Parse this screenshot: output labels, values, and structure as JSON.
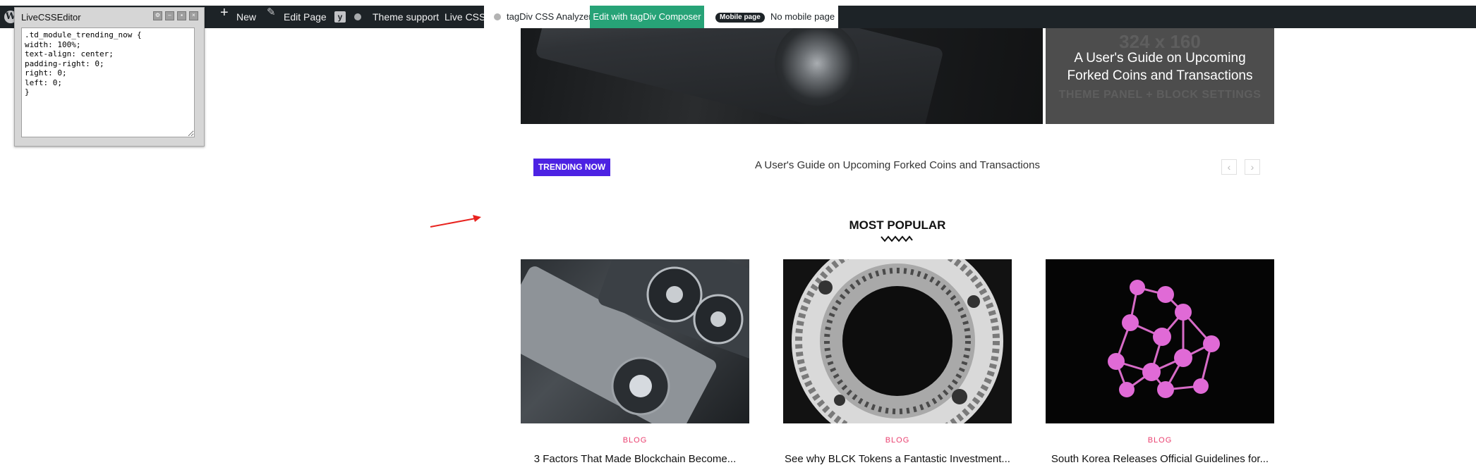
{
  "admin_bar": {
    "new_label": "New",
    "edit_page_label": "Edit Page",
    "theme_support_label": "Theme support",
    "live_css_label": "Live CSS",
    "css_analyzer_label": "tagDiv CSS Analyzer",
    "composer_label": "Edit with tagDiv Composer",
    "mobile_badge": "Mobile page",
    "no_mobile_label": "No mobile page",
    "composer_color": "#27a377"
  },
  "editor": {
    "title": "LiveCSSEditor",
    "code": ".td_module_trending_now {\nwidth: 100%;\ntext-align: center;\npadding-right: 0;\nright: 0;\nleft: 0;\n}"
  },
  "hero": {
    "placeholder_size": "324 x 160",
    "placeholder_sub": "THEME PANEL + BLOCK SETTINGS",
    "right_title": "A User's Guide on Upcoming Forked Coins and Transactions"
  },
  "trending": {
    "badge": "TRENDING NOW",
    "badge_color": "#4c22e3",
    "title": "A User's Guide on Upcoming Forked Coins and Transactions",
    "prev": "‹",
    "next": "›"
  },
  "popular": {
    "heading": "MOST POPULAR",
    "category_color": "#ea3f6f",
    "cards": [
      {
        "category": "BLOG",
        "title": "3 Factors That Made Blockchain Become..."
      },
      {
        "category": "BLOG",
        "title": "See why BLCK Tokens a Fantastic Investment..."
      },
      {
        "category": "BLOG",
        "title": "South Korea Releases Official Guidelines for..."
      }
    ]
  }
}
